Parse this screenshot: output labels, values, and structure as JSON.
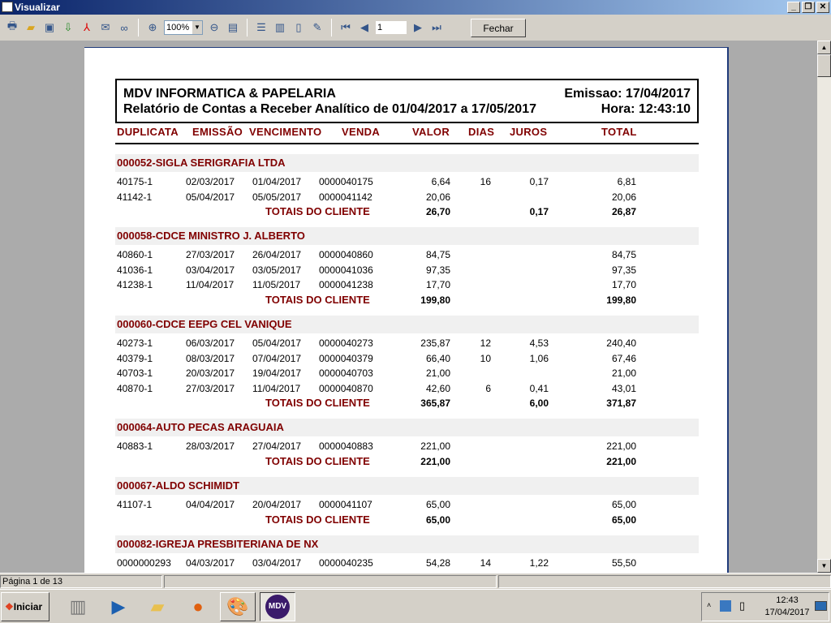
{
  "window": {
    "title": "Visualizar",
    "controls": [
      "_",
      "❐",
      "✕"
    ]
  },
  "toolbar": {
    "zoom": "100%",
    "page": "1",
    "close_label": "Fechar",
    "icons": [
      "printer-icon",
      "open-folder-icon",
      "save-icon",
      "export-icon",
      "pdf-icon",
      "email-attach-icon",
      "find-icon",
      "zoom-in-icon",
      "zoom-out-icon",
      "page-width-icon",
      "one-page-icon",
      "multi-page-icon",
      "book-icon",
      "edit-icon",
      "first-page-icon",
      "prev-page-icon",
      "next-page-icon",
      "last-page-icon"
    ]
  },
  "report": {
    "company": "MDV INFORMATICA & PAPELARIA",
    "title": "Relatório de Contas a Receber Analítico de 01/04/2017 a 17/05/2017",
    "emission": "Emissao: 17/04/2017",
    "time": "Hora: 12:43:10",
    "columns": [
      "DUPLICATA",
      "EMISSÃO",
      "VENCIMENTO",
      "VENDA",
      "VALOR",
      "DIAS",
      "JUROS",
      "TOTAL"
    ],
    "totals_label": "TOTAIS DO CLIENTE",
    "groups": [
      {
        "name": "000052-SIGLA SERIGRAFIA LTDA",
        "rows": [
          [
            "40175-1",
            "02/03/2017",
            "01/04/2017",
            "0000040175",
            "6,64",
            "16",
            "0,17",
            "6,81"
          ],
          [
            "41142-1",
            "05/04/2017",
            "05/05/2017",
            "0000041142",
            "20,06",
            "",
            "",
            "20,06"
          ]
        ],
        "totals": {
          "valor": "26,70",
          "juros": "0,17",
          "total": "26,87"
        }
      },
      {
        "name": "000058-CDCE MINISTRO J. ALBERTO",
        "rows": [
          [
            "40860-1",
            "27/03/2017",
            "26/04/2017",
            "0000040860",
            "84,75",
            "",
            "",
            "84,75"
          ],
          [
            "41036-1",
            "03/04/2017",
            "03/05/2017",
            "0000041036",
            "97,35",
            "",
            "",
            "97,35"
          ],
          [
            "41238-1",
            "11/04/2017",
            "11/05/2017",
            "0000041238",
            "17,70",
            "",
            "",
            "17,70"
          ]
        ],
        "totals": {
          "valor": "199,80",
          "juros": "",
          "total": "199,80"
        }
      },
      {
        "name": "000060-CDCE EEPG CEL VANIQUE",
        "rows": [
          [
            "40273-1",
            "06/03/2017",
            "05/04/2017",
            "0000040273",
            "235,87",
            "12",
            "4,53",
            "240,40"
          ],
          [
            "40379-1",
            "08/03/2017",
            "07/04/2017",
            "0000040379",
            "66,40",
            "10",
            "1,06",
            "67,46"
          ],
          [
            "40703-1",
            "20/03/2017",
            "19/04/2017",
            "0000040703",
            "21,00",
            "",
            "",
            "21,00"
          ],
          [
            "40870-1",
            "27/03/2017",
            "11/04/2017",
            "0000040870",
            "42,60",
            "6",
            "0,41",
            "43,01"
          ]
        ],
        "totals": {
          "valor": "365,87",
          "juros": "6,00",
          "total": "371,87"
        }
      },
      {
        "name": "000064-AUTO PECAS ARAGUAIA",
        "rows": [
          [
            "40883-1",
            "28/03/2017",
            "27/04/2017",
            "0000040883",
            "221,00",
            "",
            "",
            "221,00"
          ]
        ],
        "totals": {
          "valor": "221,00",
          "juros": "",
          "total": "221,00"
        }
      },
      {
        "name": "000067-ALDO SCHIMIDT",
        "rows": [
          [
            "41107-1",
            "04/04/2017",
            "20/04/2017",
            "0000041107",
            "65,00",
            "",
            "",
            "65,00"
          ]
        ],
        "totals": {
          "valor": "65,00",
          "juros": "",
          "total": "65,00"
        }
      },
      {
        "name": "000082-IGREJA PRESBITERIANA DE NX",
        "rows": [
          [
            "0000000293",
            "04/03/2017",
            "03/04/2017",
            "0000040235",
            "54,28",
            "14",
            "1,22",
            "55,50"
          ]
        ],
        "totals": null
      }
    ]
  },
  "status": {
    "page_info": "Página 1 de 13"
  },
  "taskbar": {
    "start": "Iniciar",
    "apps": [
      "server-manager-icon",
      "powershell-icon",
      "explorer-icon",
      "firefox-icon",
      "paint-icon",
      "mdv-app-icon"
    ],
    "mdv_logo": "MDV",
    "clock_time": "12:43",
    "clock_date": "17/04/2017"
  }
}
